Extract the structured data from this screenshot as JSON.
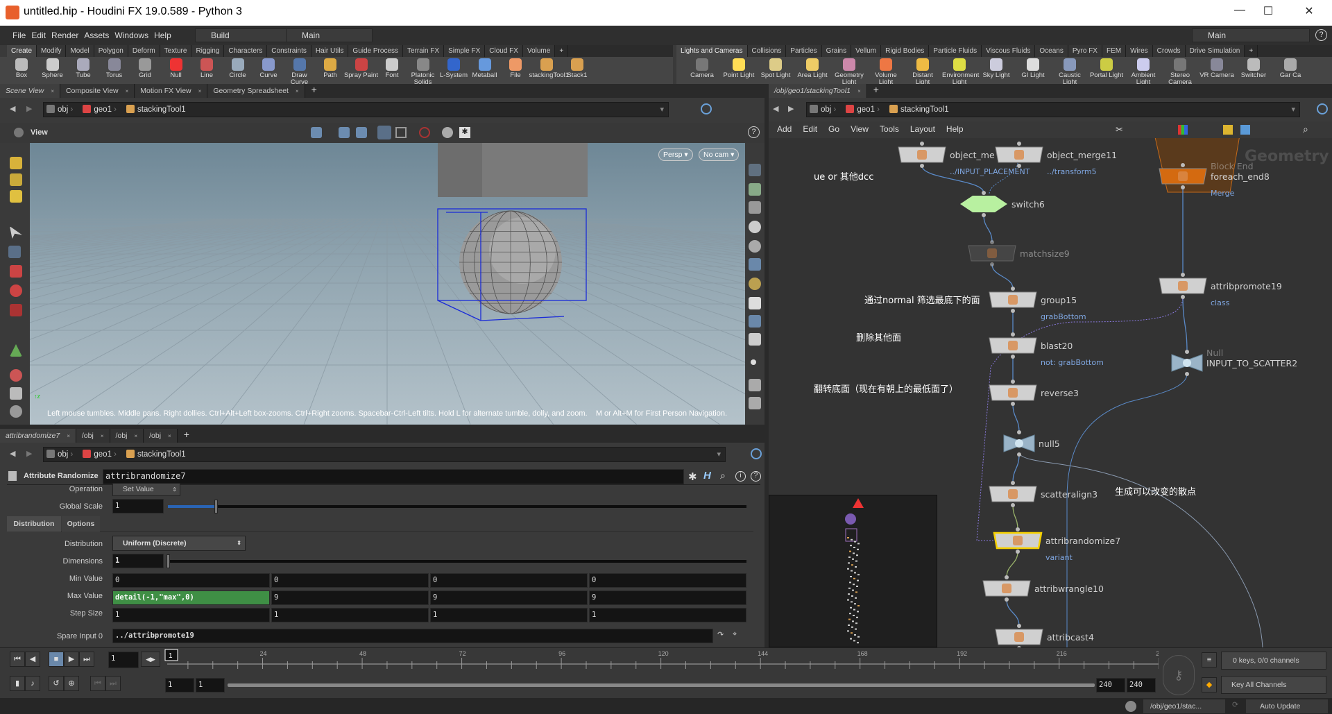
{
  "window": {
    "title": "untitled.hip - Houdini FX 19.0.589 - Python 3",
    "minimize": "—",
    "maximize": "☐",
    "close": "✕"
  },
  "menu": {
    "items": [
      "File",
      "Edit",
      "Render",
      "Assets",
      "Windows",
      "Help"
    ],
    "desktop": "Build",
    "context": "Main",
    "right_desktop": "Main"
  },
  "shelf_left": {
    "tabs": [
      "Create",
      "Modify",
      "Model",
      "Polygon",
      "Deform",
      "Texture",
      "Rigging",
      "Characters",
      "Constraints",
      "Hair Utils",
      "Guide Process",
      "Terrain FX",
      "Simple FX",
      "Cloud FX",
      "Volume"
    ],
    "tools": [
      "Box",
      "Sphere",
      "Tube",
      "Torus",
      "Grid",
      "Null",
      "Line",
      "Circle",
      "Curve",
      "Draw Curve",
      "Path",
      "Spray Paint",
      "Font",
      "Platonic Solids",
      "L-System",
      "Metaball",
      "File",
      "stackingTool1",
      "Stack1"
    ]
  },
  "shelf_right": {
    "tabs": [
      "Lights and Cameras",
      "Collisions",
      "Particles",
      "Grains",
      "Vellum",
      "Rigid Bodies",
      "Particle Fluids",
      "Viscous Fluids",
      "Oceans",
      "Pyro FX",
      "FEM",
      "Wires",
      "Crowds",
      "Drive Simulation"
    ],
    "tools": [
      "Camera",
      "Point Light",
      "Spot Light",
      "Area Light",
      "Geometry Light",
      "Volume Light",
      "Distant Light",
      "Environment Light",
      "Sky Light",
      "GI Light",
      "Caustic Light",
      "Portal Light",
      "Ambient Light",
      "Stereo Camera",
      "VR Camera",
      "Switcher",
      "Gar Ca"
    ]
  },
  "scene_pane": {
    "tabs": [
      "Scene View",
      "Composite View",
      "Motion FX View",
      "Geometry Spreadsheet"
    ],
    "path": [
      "obj",
      "geo1",
      "stackingTool1"
    ],
    "view_label": "View",
    "persp": "Persp ▾",
    "cam": "No cam ▾",
    "help_text": "Left mouse tumbles. Middle pans. Right dollies. Ctrl+Alt+Left box-zooms. Ctrl+Right zooms. Spacebar-Ctrl-Left tilts. Hold L for alternate tumble, dolly, and zoom.",
    "help_text2": "M or Alt+M for First Person Navigation."
  },
  "param_pane": {
    "tabs": [
      "attribrandomize7",
      "/obj",
      "/obj",
      "/obj"
    ],
    "path": [
      "obj",
      "geo1",
      "stackingTool1"
    ],
    "node_type": "Attribute Randomize",
    "node_name": "attribrandomize7",
    "operation": {
      "label": "Operation",
      "value": "Set Value"
    },
    "global_scale": {
      "label": "Global Scale",
      "value": "1",
      "slider_fraction": 0.08
    },
    "folder_tabs": [
      "Distribution",
      "Options"
    ],
    "distribution": {
      "label": "Distribution",
      "value": "Uniform (Discrete)"
    },
    "dimensions": {
      "label": "Dimensions",
      "value": "1",
      "slider_fraction": 0.0
    },
    "min_value": {
      "label": "Min Value",
      "values": [
        "0",
        "0",
        "0",
        "0"
      ]
    },
    "max_value": {
      "label": "Max Value",
      "values": [
        "detail(-1,\"max\",0)",
        "9",
        "9",
        "9"
      ]
    },
    "step_size": {
      "label": "Step Size",
      "values": [
        "1",
        "1",
        "1",
        "1"
      ]
    },
    "spare_input": {
      "label": "Spare Input 0",
      "value": "../attribpromote19"
    },
    "expression_color": "#3f8f45"
  },
  "network_pane": {
    "tab": "/obj/geo1/stackingTool1",
    "path": [
      "obj",
      "geo1",
      "stackingTool1"
    ],
    "menu": [
      "Add",
      "Edit",
      "Go",
      "View",
      "Tools",
      "Layout",
      "Help"
    ],
    "watermark": "Geometry",
    "nodes": [
      {
        "id": "om1",
        "name": "object_me",
        "sub": "../INPUT_PLACEMENT"
      },
      {
        "id": "om11",
        "name": "object_merge11",
        "sub": "../transform5"
      },
      {
        "id": "switch6",
        "name": "switch6",
        "sub": ""
      },
      {
        "id": "matchsize9",
        "name": "matchsize9",
        "sub": ""
      },
      {
        "id": "group15",
        "name": "group15",
        "sub": "grabBottom"
      },
      {
        "id": "blast20",
        "name": "blast20",
        "sub": "not: grabBottom"
      },
      {
        "id": "reverse3",
        "name": "reverse3",
        "sub": ""
      },
      {
        "id": "null5",
        "name": "null5",
        "sub": ""
      },
      {
        "id": "scatteralign3",
        "name": "scatteralign3",
        "sub": ""
      },
      {
        "id": "attribrandomize7",
        "name": "attribrandomize7",
        "sub": "variant"
      },
      {
        "id": "attribwrangle10",
        "name": "attribwrangle10",
        "sub": ""
      },
      {
        "id": "attribcast4",
        "name": "attribcast4",
        "sub": ""
      },
      {
        "id": "foreach_end8",
        "name": "foreach_end8",
        "sub": "Merge",
        "type": "Block End"
      },
      {
        "id": "attribpromote19",
        "name": "attribpromote19",
        "sub": "class"
      },
      {
        "id": "input_to_scatter2",
        "name": "INPUT_TO_SCATTER2",
        "sub": "",
        "type": "Null"
      }
    ],
    "notes": [
      "ue or 其他dcc",
      "通过normal 筛选最底下的面",
      "删除其他面",
      "翻转底面（现在有朝上的最低面了）",
      "生成可以改变的散点"
    ]
  },
  "timeline": {
    "current_frame": "1",
    "tick_labels": [
      "24",
      "48",
      "72",
      "96",
      "120",
      "144",
      "168",
      "192",
      "216",
      "2"
    ],
    "range_start": "1",
    "range_start2": "1",
    "range_end": "240",
    "range_end2": "240",
    "keys": "0 keys, 0/0 channels",
    "key_channels": "Key All Channels"
  },
  "status": {
    "path": "/obj/geo1/stac...",
    "update": "Auto Update"
  }
}
